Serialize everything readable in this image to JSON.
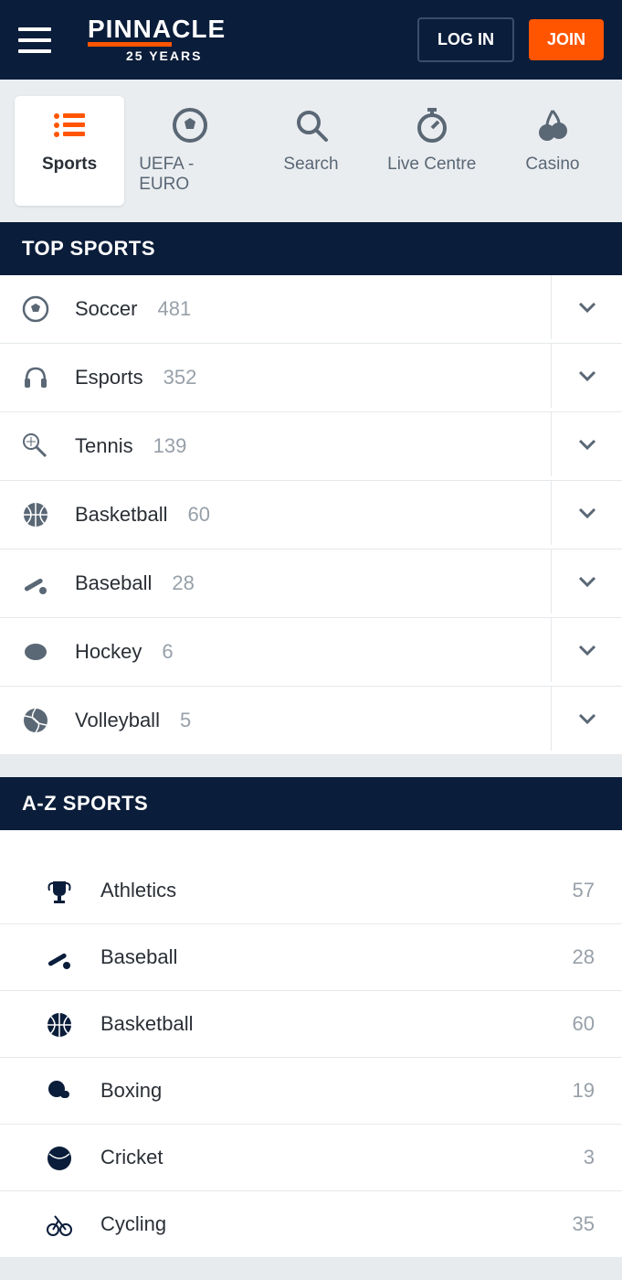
{
  "header": {
    "logo_main": "PINNACLE",
    "logo_sub": "25 YEARS",
    "login_label": "LOG IN",
    "join_label": "JOIN"
  },
  "nav": {
    "items": [
      {
        "label": "Sports",
        "icon": "list"
      },
      {
        "label": "UEFA - EURO",
        "icon": "soccer"
      },
      {
        "label": "Search",
        "icon": "search"
      },
      {
        "label": "Live Centre",
        "icon": "stopwatch"
      },
      {
        "label": "Casino",
        "icon": "cherry"
      }
    ]
  },
  "sections": {
    "top_sports_title": "TOP SPORTS",
    "az_sports_title": "A-Z SPORTS"
  },
  "top_sports": [
    {
      "name": "Soccer",
      "count": "481",
      "icon": "soccer"
    },
    {
      "name": "Esports",
      "count": "352",
      "icon": "headphones"
    },
    {
      "name": "Tennis",
      "count": "139",
      "icon": "tennis"
    },
    {
      "name": "Basketball",
      "count": "60",
      "icon": "basketball"
    },
    {
      "name": "Baseball",
      "count": "28",
      "icon": "baseball"
    },
    {
      "name": "Hockey",
      "count": "6",
      "icon": "hockey"
    },
    {
      "name": "Volleyball",
      "count": "5",
      "icon": "volleyball"
    }
  ],
  "az_sports": [
    {
      "name": "Athletics",
      "count": "57",
      "icon": "trophy"
    },
    {
      "name": "Baseball",
      "count": "28",
      "icon": "baseball"
    },
    {
      "name": "Basketball",
      "count": "60",
      "icon": "basketball"
    },
    {
      "name": "Boxing",
      "count": "19",
      "icon": "boxing"
    },
    {
      "name": "Cricket",
      "count": "3",
      "icon": "cricket"
    },
    {
      "name": "Cycling",
      "count": "35",
      "icon": "cycling"
    }
  ],
  "colors": {
    "accent": "#ff5500",
    "dark": "#0a1d3a",
    "grey": "#5a6775"
  }
}
